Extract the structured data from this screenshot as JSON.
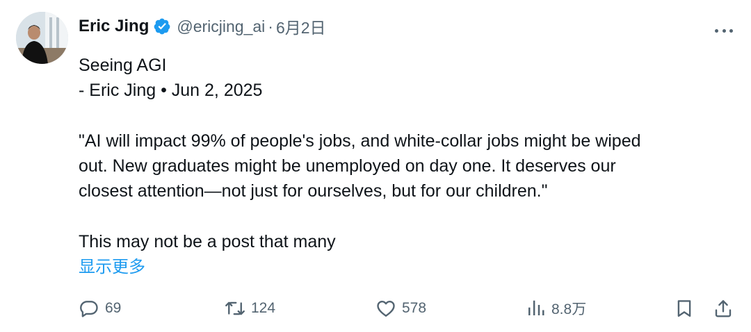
{
  "author": {
    "display_name": "Eric Jing",
    "handle": "@ericjing_ai",
    "separator": "·",
    "date": "6月2日",
    "verified": true
  },
  "post": {
    "lines": [
      "Seeing AGI",
      "- Eric Jing • Jun 2, 2025",
      "",
      "\"AI will impact 99% of people's jobs, and white-collar jobs might be wiped",
      "out. New graduates might be unemployed on day one. It deserves our",
      "closest attention—not just for ourselves, but for our children.\"",
      "",
      "This may not be a post that many"
    ],
    "show_more_label": "显示更多"
  },
  "actions": {
    "reply_count": "69",
    "retweet_count": "124",
    "like_count": "578",
    "views_count": "8.8万"
  },
  "icons": {
    "more": "more-dots-icon",
    "verified": "verified-badge-icon",
    "reply": "reply-icon",
    "retweet": "retweet-icon",
    "like": "heart-icon",
    "views": "views-icon",
    "bookmark": "bookmark-icon",
    "share": "share-icon"
  },
  "colors": {
    "text_primary": "#0f1419",
    "text_secondary": "#536471",
    "accent": "#1d9bf0"
  }
}
